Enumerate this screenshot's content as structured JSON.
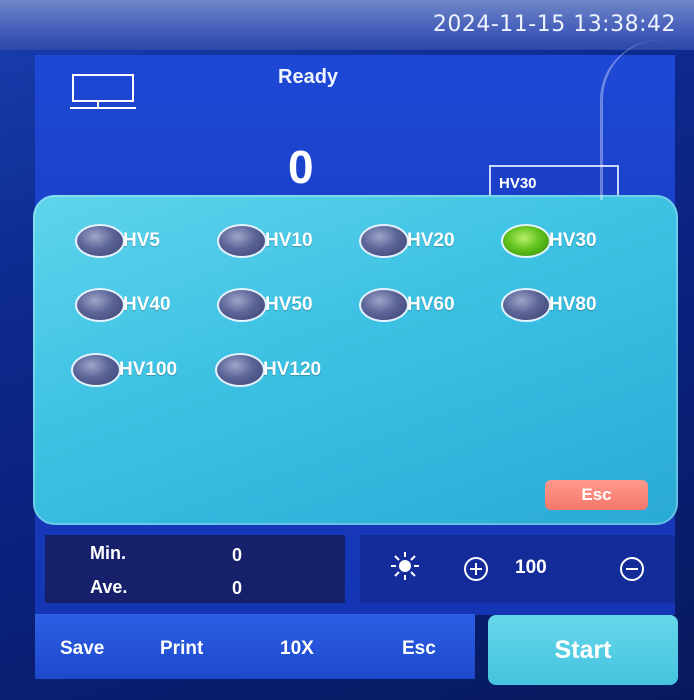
{
  "header": {
    "datetime": "2024-11-15 13:38:42",
    "status": "Ready"
  },
  "counter": "0",
  "current_mode": "HV30",
  "options": [
    {
      "label": "HV5",
      "selected": false
    },
    {
      "label": "HV10",
      "selected": false
    },
    {
      "label": "HV20",
      "selected": false
    },
    {
      "label": "HV30",
      "selected": true
    },
    {
      "label": "HV40",
      "selected": false
    },
    {
      "label": "HV50",
      "selected": false
    },
    {
      "label": "HV60",
      "selected": false
    },
    {
      "label": "HV80",
      "selected": false
    },
    {
      "label": "HV100",
      "selected": false
    },
    {
      "label": "HV120",
      "selected": false
    }
  ],
  "panel": {
    "esc_label": "Esc"
  },
  "stats": {
    "min_label": "Min.",
    "min_value": "0",
    "ave_label": "Ave.",
    "ave_value": "0"
  },
  "brightness": {
    "value": "100",
    "icon": "sun-icon"
  },
  "toolbar": {
    "save": "Save",
    "print": "Print",
    "zoom": "10X",
    "esc": "Esc"
  },
  "start_label": "Start",
  "colors": {
    "selected": "#62c31e",
    "panel": "#3cc1e3",
    "accent": "#1d48d6"
  }
}
